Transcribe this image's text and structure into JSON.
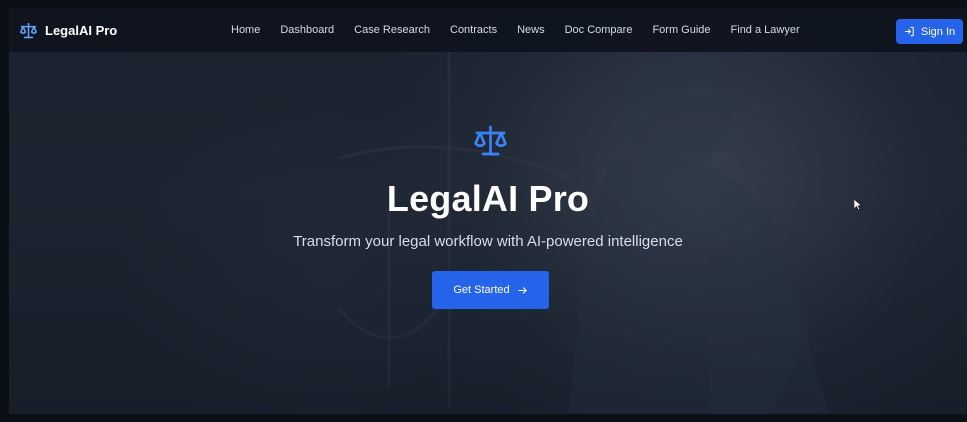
{
  "brand": {
    "name": "LegalAI Pro",
    "icon": "scale-icon"
  },
  "nav": {
    "items": [
      {
        "label": "Home"
      },
      {
        "label": "Dashboard"
      },
      {
        "label": "Case Research"
      },
      {
        "label": "Contracts"
      },
      {
        "label": "News"
      },
      {
        "label": "Doc Compare"
      },
      {
        "label": "Form Guide"
      },
      {
        "label": "Find a Lawyer"
      }
    ],
    "signin_label": "Sign In",
    "signin_icon": "sign-in-icon"
  },
  "hero": {
    "icon": "scale-icon",
    "title": "LegalAI Pro",
    "subtitle": "Transform your legal workflow with AI-powered intelligence",
    "cta_label": "Get Started",
    "cta_icon": "arrow-right-icon"
  },
  "colors": {
    "accent": "#2563eb",
    "icon_blue": "#3b82f6",
    "navbar_bg": "#0e131d"
  }
}
